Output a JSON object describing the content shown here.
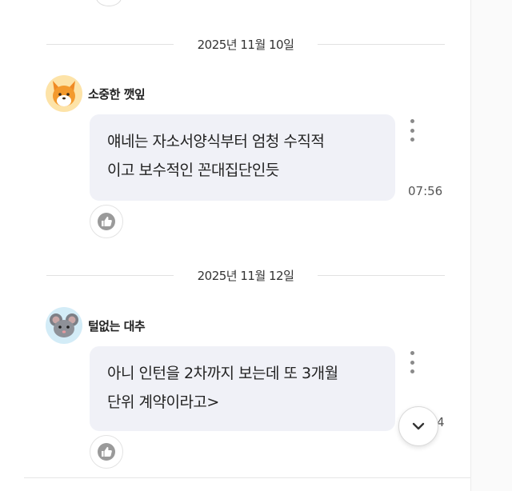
{
  "messages": [
    {
      "date": "2025년 11월 10일",
      "nickname": "소중한 깻잎",
      "avatar_icon": "fox-avatar-icon",
      "text_lines": [
        "얘네는 자소서양식부터 엄청 수직적",
        "이고 보수적인 꼰대집단인듯"
      ],
      "time": "07:56"
    },
    {
      "date": "2025년 11월 12일",
      "nickname": "털없는 대추",
      "avatar_icon": "mouse-avatar-icon",
      "text_lines": [
        "아니 인턴을 2차까지 보는데 또 3개월",
        "단위 계약이라고>"
      ],
      "time_partial": "4"
    }
  ],
  "colors": {
    "bubble_bg": "#f0f1f7",
    "fox_avatar_bg": "#fde3a8",
    "mouse_avatar_bg": "#d3ecf7"
  },
  "icons": {
    "like": "thumbs-up-icon",
    "more": "kebab-menu-icon",
    "scroll": "chevron-down-icon"
  }
}
